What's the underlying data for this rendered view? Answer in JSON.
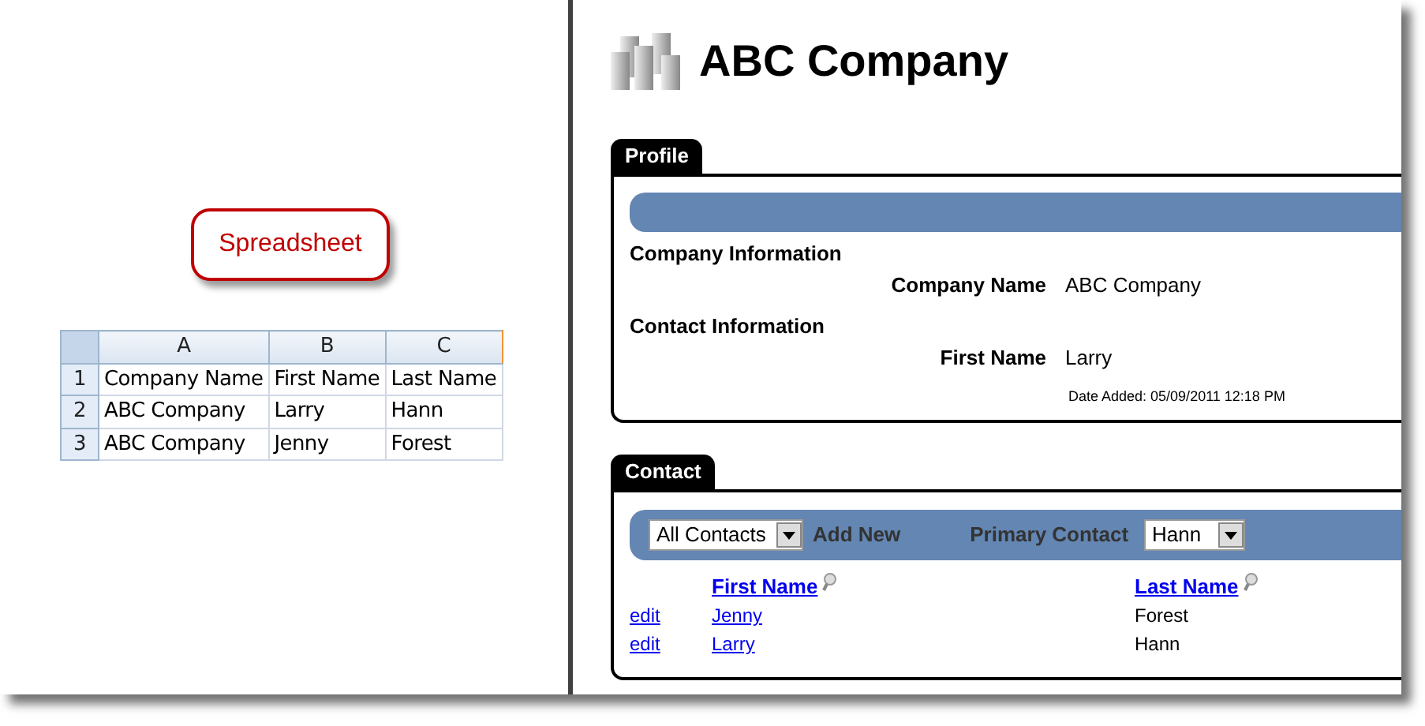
{
  "callout": {
    "label": "Spreadsheet"
  },
  "spreadsheet": {
    "columns": [
      "A",
      "B",
      "C"
    ],
    "rows": [
      {
        "number": "1",
        "cells": [
          "Company Name",
          "First Name",
          "Last Name"
        ]
      },
      {
        "number": "2",
        "cells": [
          "ABC Company",
          "Larry",
          "Hann"
        ]
      },
      {
        "number": "3",
        "cells": [
          "ABC Company",
          "Jenny",
          "Forest"
        ]
      }
    ]
  },
  "company": {
    "title": "ABC Company"
  },
  "profile": {
    "tab": "Profile",
    "sections": [
      {
        "heading": "Company Information",
        "fields": [
          {
            "label": "Company Name",
            "value": "ABC Company"
          }
        ]
      },
      {
        "heading": "Contact Information",
        "fields": [
          {
            "label": "First Name",
            "value": "Larry"
          }
        ]
      }
    ],
    "date_added": "Date Added: 05/09/2011 12:18 PM"
  },
  "contact": {
    "tab": "Contact",
    "filter": {
      "value": "All Contacts"
    },
    "add_new": "Add New",
    "primary_label": "Primary Contact",
    "primary": {
      "value": "Hann"
    },
    "columns": [
      "First Name",
      "Last Name"
    ],
    "rows": [
      {
        "action": "edit",
        "first_name": "Jenny",
        "last_name": "Forest"
      },
      {
        "action": "edit",
        "first_name": "Larry",
        "last_name": "Hann"
      }
    ]
  }
}
